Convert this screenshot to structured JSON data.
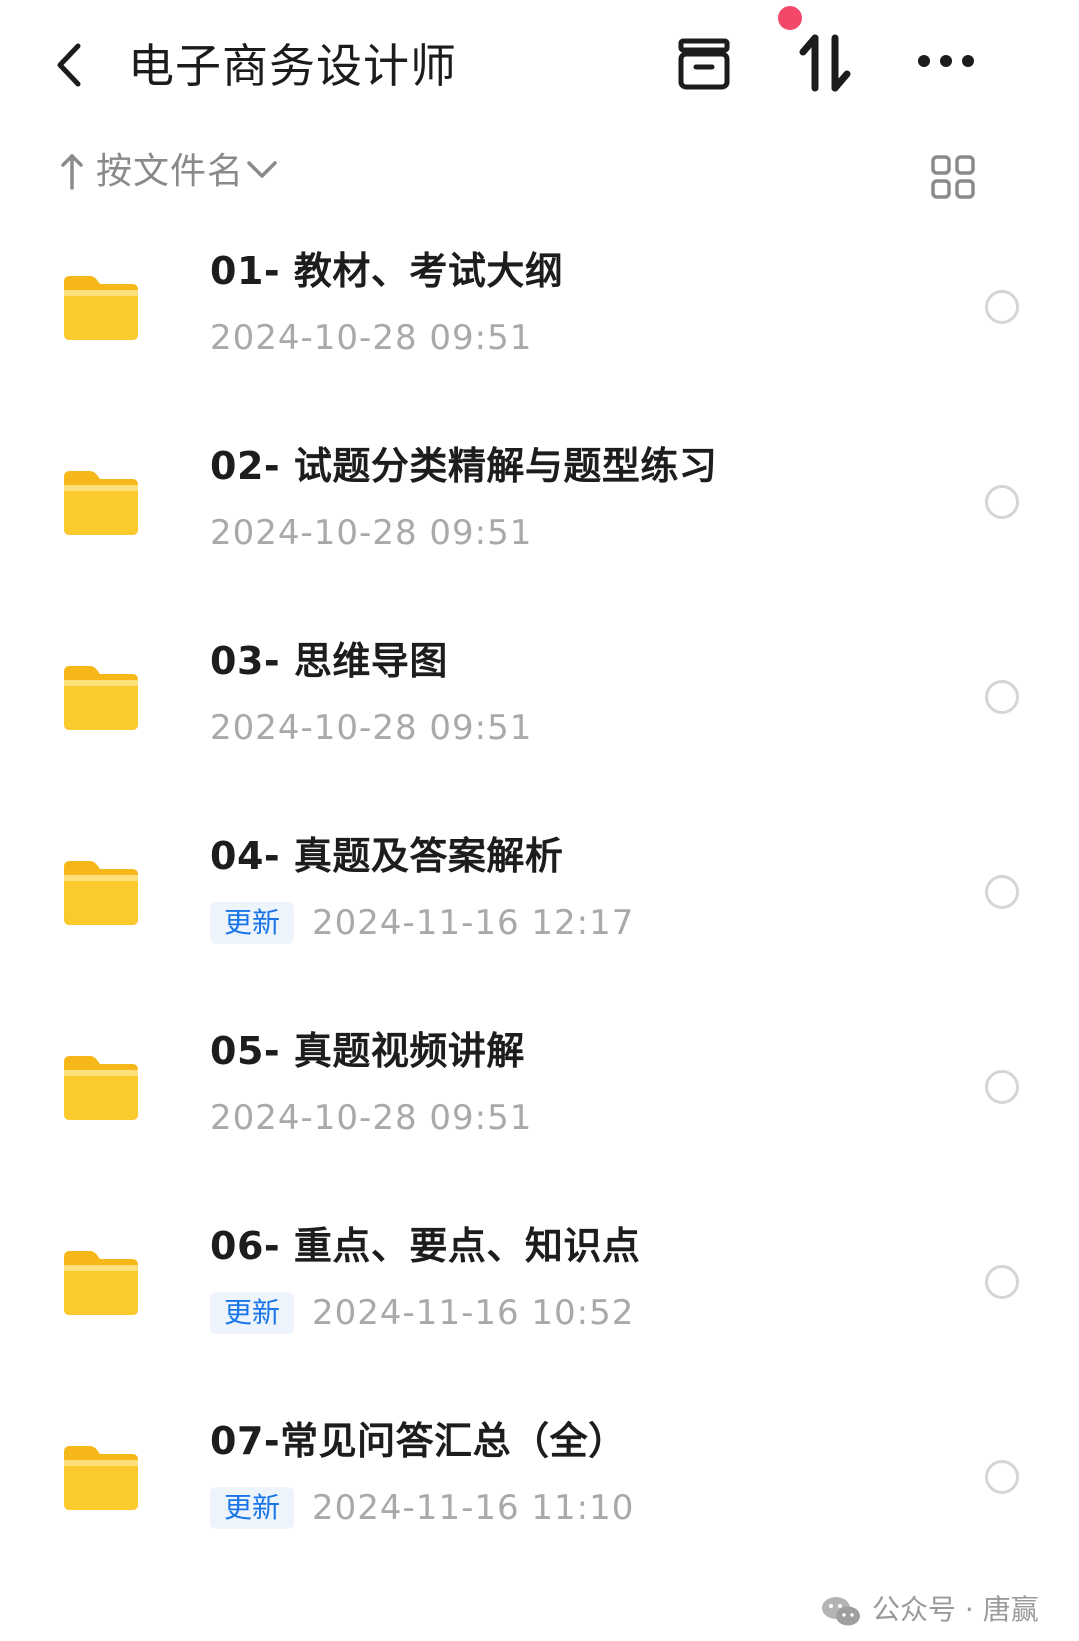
{
  "header": {
    "title": "电子商务设计师",
    "back_icon": "chevron-left-icon",
    "icons": [
      "archive-icon",
      "sort-arrows-icon",
      "more-icon"
    ],
    "notification_dot_color": "#f2496a"
  },
  "sort_bar": {
    "label": "按文件名",
    "direction_icon": "arrow-up-icon",
    "dropdown_icon": "chevron-down-icon",
    "view_icon": "grid-view-icon"
  },
  "folders": [
    {
      "name": "01- 教材、考试大纲",
      "badge": "",
      "date": "2024-10-28  09:51"
    },
    {
      "name": "02- 试题分类精解与题型练习",
      "badge": "",
      "date": "2024-10-28  09:51"
    },
    {
      "name": "03- 思维导图",
      "badge": "",
      "date": "2024-10-28  09:51"
    },
    {
      "name": "04- 真题及答案解析",
      "badge": "更新",
      "date": "2024-11-16  12:17"
    },
    {
      "name": "05- 真题视频讲解",
      "badge": "",
      "date": "2024-10-28  09:51"
    },
    {
      "name": "06- 重点、要点、知识点",
      "badge": "更新",
      "date": "2024-11-16  10:52"
    },
    {
      "name": "07-常见问答汇总（全）",
      "badge": "更新",
      "date": "2024-11-16  11:10"
    }
  ],
  "watermark": {
    "text": "公众号 · 唐赢",
    "icon": "wechat-icon"
  },
  "colors": {
    "folder": "#fbcb2e",
    "badge_text": "#1976e8",
    "badge_bg": "#eef4fb",
    "meta_text": "#a9a9a9"
  }
}
